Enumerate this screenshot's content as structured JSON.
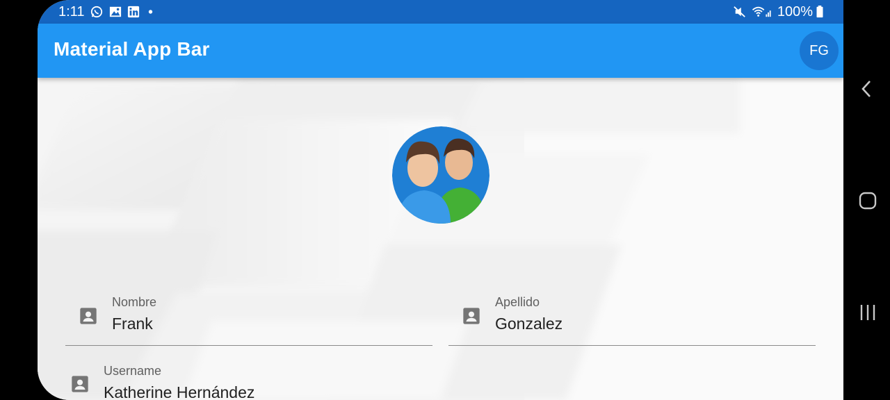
{
  "status_bar": {
    "time": "1:11",
    "battery": "100%"
  },
  "app_bar": {
    "title": "Material App Bar",
    "avatar_initials": "FG"
  },
  "form": {
    "nombre": {
      "label": "Nombre",
      "value": "Frank"
    },
    "apellido": {
      "label": "Apellido",
      "value": "Gonzalez"
    },
    "username": {
      "label": "Username",
      "value": "Katherine Hernández"
    }
  },
  "colors": {
    "app_bar": "#2196f3",
    "status_bar": "#1565c0",
    "avatar": "#1976d2"
  }
}
